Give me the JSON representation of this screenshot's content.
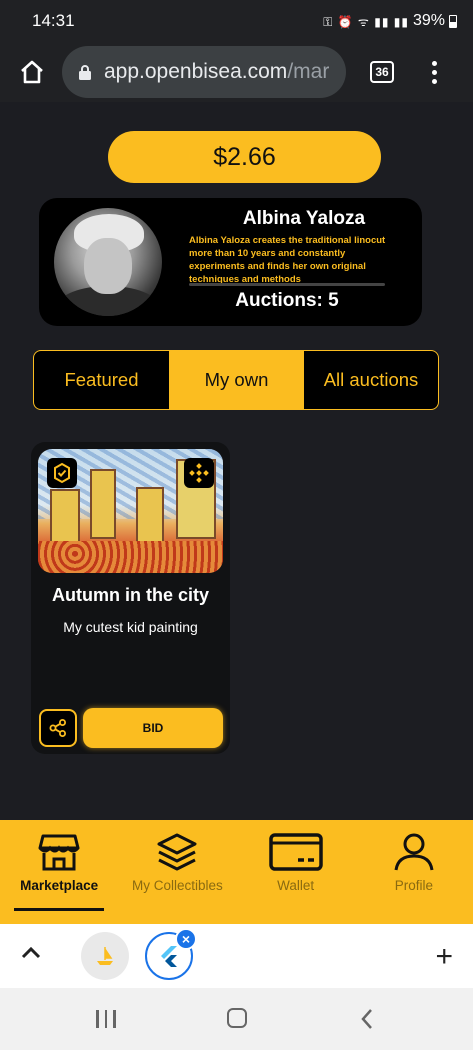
{
  "status_bar": {
    "time": "14:31",
    "battery": "39%"
  },
  "browser": {
    "url_main": "app.openbisea.com",
    "url_tail": "/mar",
    "tab_count": "36"
  },
  "balance": "$2.66",
  "artist": {
    "name": "Albina Yaloza",
    "bio": "Albina Yaloza creates the traditional linocut more than 10 years and constantly experiments and finds her own original techniques and methods",
    "auctions": "Auctions: 5"
  },
  "tabs": [
    {
      "label": "Featured",
      "active": false
    },
    {
      "label": "My own",
      "active": true
    },
    {
      "label": "All auctions",
      "active": false
    }
  ],
  "nft_card": {
    "title": "Autumn in the city",
    "subtitle": "My cutest kid painting",
    "bid_label": "BID"
  },
  "bottom_nav": [
    {
      "label": "Marketplace",
      "icon": "store-icon",
      "active": true
    },
    {
      "label": "My Collectibles",
      "icon": "layers-icon",
      "active": false
    },
    {
      "label": "Wallet",
      "icon": "wallet-icon",
      "active": false
    },
    {
      "label": "Profile",
      "icon": "user-icon",
      "active": false
    }
  ],
  "colors": {
    "accent": "#fbbd20",
    "background": "#1c1d22",
    "card": "#111214"
  }
}
